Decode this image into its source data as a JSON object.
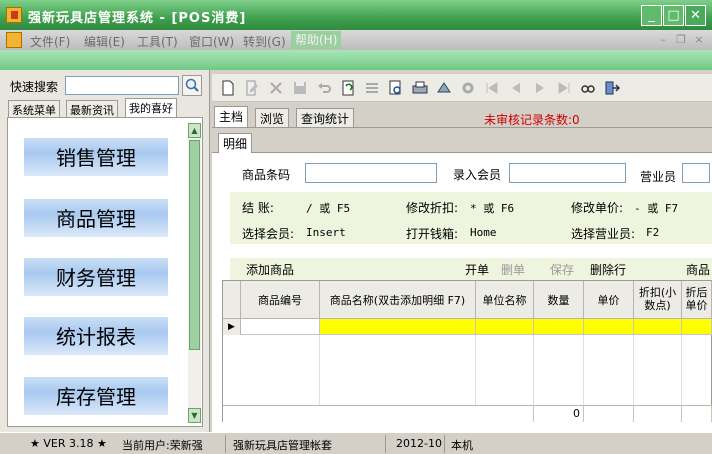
{
  "window": {
    "title": "强新玩具店管理系统 - [POS消费]"
  },
  "menu": [
    "文件(F)",
    "编辑(E)",
    "工具(T)",
    "窗口(W)",
    "转到(G)",
    "帮助(H)"
  ],
  "left": {
    "quick_search_label": "快速搜索",
    "quick_search_value": "",
    "tabs": [
      "系统菜单",
      "最新资讯",
      "我的喜好"
    ],
    "nav": [
      "销售管理",
      "商品管理",
      "财务管理",
      "统计报表",
      "库存管理"
    ]
  },
  "tabs": [
    "主档",
    "浏览",
    "查询统计"
  ],
  "unreviewed": "未审核记录条数:0",
  "detail": {
    "tab": "明细",
    "barcode_label": "商品条码",
    "member_label": "录入会员",
    "staff_label": "营业员",
    "hints": {
      "settle_cn": "结    账:",
      "settle_key": "/ 或 F5",
      "discount_cn": "修改折扣:",
      "discount_key": "* 或 F6",
      "price_cn": "修改单价:",
      "price_key": "- 或 F7",
      "member_cn": "选择会员:",
      "member_key": "Insert",
      "cashbox_cn": "打开钱箱:",
      "cashbox_key": "Home",
      "staff_cn": "选择营业员:",
      "staff_key": "F2"
    },
    "add_label": "添加商品",
    "actions": {
      "open": "开单",
      "delete": "删单",
      "save": "保存",
      "delete_row": "删除行",
      "goods": "商品"
    }
  },
  "grid": {
    "columns": [
      "商品编号",
      "商品名称(双击添加明细 F7)",
      "单位名称",
      "数量",
      "单价",
      "折扣(小数点)",
      "折后单价"
    ],
    "rows": [
      [
        "",
        "",
        "",
        "",
        "",
        "",
        ""
      ]
    ],
    "sum_qty": "0"
  },
  "status": {
    "version": "★ VER 3.18 ★",
    "user": "当前用户:荣新强",
    "account": "强新玩具店管理帐套",
    "period": "2012-10",
    "location": "本机"
  },
  "colors": {
    "title_green": "#3fa04e",
    "grid_highlight": "#ffff00",
    "unreviewed": "#d00000"
  }
}
